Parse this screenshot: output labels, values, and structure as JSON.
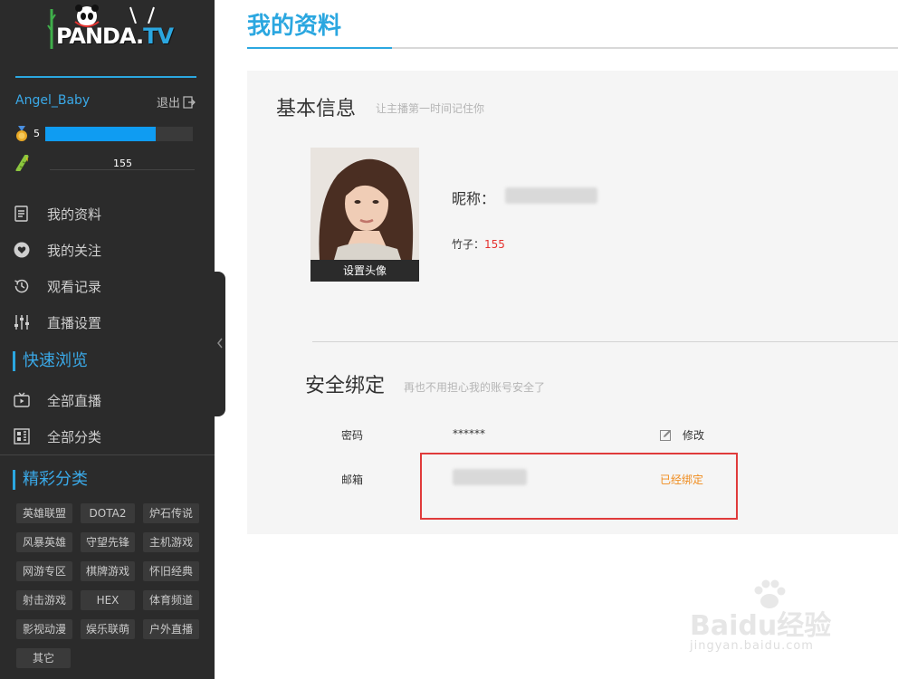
{
  "logo": {
    "text_main": "PANDA",
    "text_dot": ".",
    "text_tv": "TV"
  },
  "user": {
    "name": "Angel_Baby",
    "logout_label": "退出",
    "level": "5",
    "level_progress": 0.75,
    "bamboo": "155"
  },
  "nav": {
    "items": [
      {
        "label": "我的资料",
        "icon": "document-icon"
      },
      {
        "label": "我的关注",
        "icon": "heart-icon"
      },
      {
        "label": "观看记录",
        "icon": "history-icon"
      },
      {
        "label": "直播设置",
        "icon": "sliders-icon"
      }
    ]
  },
  "quick": {
    "title": "快速浏览",
    "items": [
      {
        "label": "全部直播",
        "icon": "tv-icon"
      },
      {
        "label": "全部分类",
        "icon": "grid-icon"
      }
    ]
  },
  "categories": {
    "title": "精彩分类",
    "tags": [
      "英雄联盟",
      "DOTA2",
      "炉石传说",
      "风暴英雄",
      "守望先锋",
      "主机游戏",
      "网游专区",
      "棋牌游戏",
      "怀旧经典",
      "射击游戏",
      "HEX",
      "体育频道",
      "影视动漫",
      "娱乐联萌",
      "户外直播",
      "其它"
    ]
  },
  "main": {
    "page_title": "我的资料",
    "basic": {
      "title": "基本信息",
      "subtitle": "让主播第一时间记住你",
      "avatar_button": "设置头像",
      "nickname_label": "昵称：",
      "bamboo_label": "竹子：",
      "bamboo_value": "155"
    },
    "security": {
      "title": "安全绑定",
      "subtitle": "再也不用担心我的账号安全了",
      "password_label": "密码",
      "password_value": "******",
      "edit_label": "修改",
      "email_label": "邮箱",
      "email_status": "已经绑定"
    }
  },
  "watermark": {
    "text": "Baidu经验",
    "sub": "jingyan.baidu.com"
  },
  "colors": {
    "accent": "#2ba7e0",
    "sidebar_bg": "#2b2b2b",
    "panel_bg": "#f5f5f5",
    "bound_status": "#f08c1e",
    "highlight": "#e03b3b",
    "bamboo_value": "#e5322f"
  }
}
